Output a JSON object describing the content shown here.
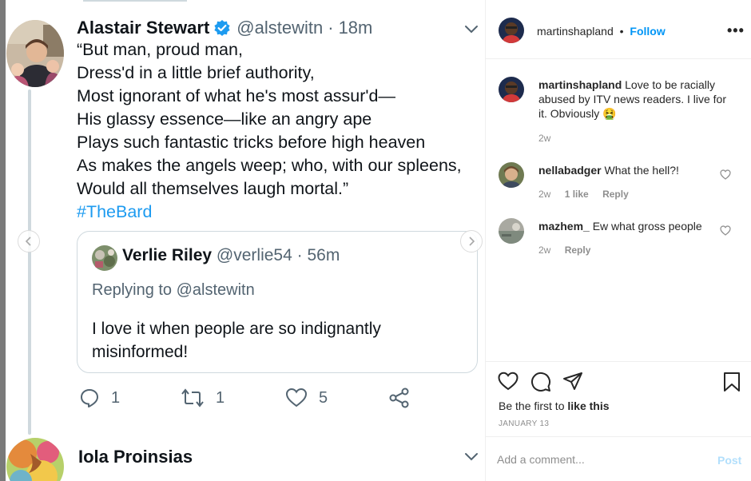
{
  "tweet": {
    "author_name": "Alastair Stewart",
    "author_handle": "@alstewitn",
    "time": "18m",
    "dot": "·",
    "lines": [
      "“But man, proud man,",
      "Dress'd in a little brief authority,",
      "Most ignorant of what he's most assur'd—",
      "His glassy essence—like an angry ape",
      "Plays such fantastic tricks before high heaven",
      "As makes the angels weep; who, with our spleens,",
      "Would all themselves laugh mortal.”"
    ],
    "hashtag": "#TheBard",
    "quote": {
      "author_name": "Verlie Riley",
      "author_handle": "@verlie54",
      "time": "56m",
      "replying_to": "Replying to @alstewitn",
      "text_lines": [
        "I love it when people are so indignantly",
        "misinformed!"
      ]
    },
    "actions": {
      "replies": "1",
      "retweets": "1",
      "likes": "5"
    },
    "next_author_name": "Iola Proinsias",
    "colors": {
      "accent": "#1d9bf0",
      "text": "#0f1419",
      "muted": "#536471"
    }
  },
  "instagram": {
    "username": "martinshapland",
    "follow_label": "Follow",
    "dot": "•",
    "caption": {
      "username": "martinshapland",
      "text": "Love to be racially abused by ITV news readers. I live for it. Obviously",
      "emoji": "🤮",
      "time": "2w"
    },
    "comments": [
      {
        "username": "nellabadger",
        "text": "What the hell?!",
        "time": "2w",
        "likes": "1 like",
        "reply_label": "Reply"
      },
      {
        "username": "mazhem_",
        "text": "Ew what gross people",
        "time": "2w",
        "likes": "",
        "reply_label": "Reply"
      }
    ],
    "likes_prefix": "Be the first to",
    "likes_link": "like this",
    "date": "JANUARY 13",
    "comment_placeholder": "Add a comment...",
    "post_label": "Post",
    "colors": {
      "link": "#0095f6",
      "post_disabled": "#b2dffc",
      "muted": "#8e8e8e"
    }
  }
}
